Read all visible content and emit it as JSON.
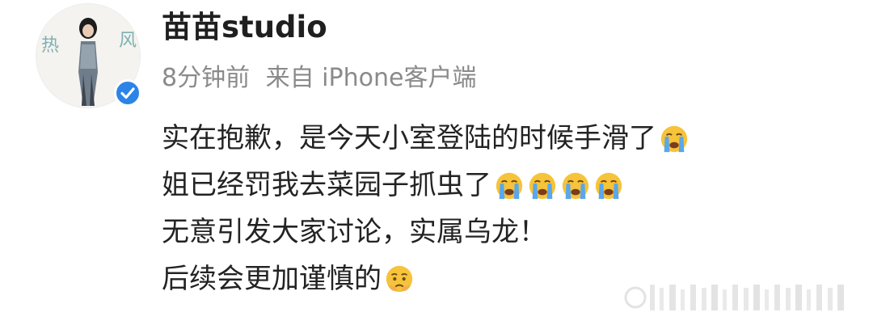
{
  "post": {
    "username": "苗苗studio",
    "time_ago": "8分钟前",
    "source": "来自 iPhone客户端",
    "avatar_text": [
      "热",
      "风"
    ],
    "lines": [
      {
        "text": "实在抱歉，是今天小室登陆的时候手滑了",
        "emoji": [
          "crying-face"
        ]
      },
      {
        "text": "姐已经罚我去菜园子抓虫了",
        "emoji": [
          "crying-face",
          "crying-face",
          "crying-face",
          "crying-face"
        ]
      },
      {
        "text": "无意引发大家讨论，实属乌龙！",
        "emoji": []
      },
      {
        "text": "后续会更加谨慎的",
        "emoji": [
          "pleading-face"
        ]
      }
    ]
  },
  "colors": {
    "verified": "#2c84e7",
    "meta_gray": "#8a8a8a",
    "emoji_yellow": "#f6c33a",
    "tears_blue": "#5aa7ea"
  }
}
